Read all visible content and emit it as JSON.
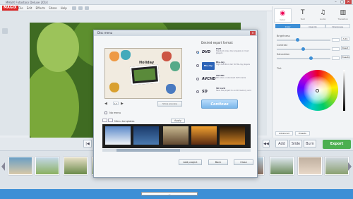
{
  "colors": {
    "accent": "#3d8fd6",
    "export_green": "#4caf50",
    "logo_red": "#dd2222"
  },
  "window": {
    "title": "MAGIX Fotostory Deluxe 2014",
    "icons": [
      "minimize-icon",
      "maximize-icon",
      "close-icon"
    ]
  },
  "menubar": {
    "logo": "MAGIX",
    "items": [
      "File",
      "Edit",
      "Effects",
      "Share",
      "Help"
    ]
  },
  "right_panel": {
    "tabs": [
      {
        "label": "Color",
        "icon": "color-wheel-icon"
      },
      {
        "label": "Text",
        "icon": "text-icon"
      },
      {
        "label": "Audio",
        "icon": "audio-icon"
      },
      {
        "label": "Transition",
        "icon": "transition-icon"
      }
    ],
    "subtabs": [
      "Color",
      "Opacity",
      "Sharpness"
    ],
    "sliders": [
      {
        "label": "Brightness",
        "value": 0.35,
        "button": "Auto"
      },
      {
        "label": "Contrast",
        "value": 0.45,
        "button": "Reset"
      },
      {
        "label": "Saturation",
        "value": 0.6,
        "button": "Presets"
      }
    ],
    "color_label": "Tint",
    "footer": [
      "Advanced",
      "Presets"
    ]
  },
  "dialog": {
    "title": "Disc menu",
    "preview_title": "Holiday",
    "page": "1/1",
    "preview_button": "Show preview",
    "no_menu": "No menu",
    "templates_label": "Menu templates",
    "apply_label": "Apply",
    "format_title": "Desired export format:",
    "formats": [
      {
        "logo": "DVD",
        "name": "DVD",
        "desc": "Standard video disc playable in most players"
      },
      {
        "logo": "Blu-ray",
        "name": "Blu-ray",
        "desc": "High definition disc for Blu-ray players"
      },
      {
        "logo": "AVCHD",
        "name": "AVCHD",
        "desc": "HD video on standard DVD media"
      },
      {
        "logo": "SD",
        "name": "SD card",
        "desc": "Save the project to an SD memory card"
      }
    ],
    "continue_label": "Continue",
    "buttons": [
      "Add project",
      "Back",
      "Close"
    ]
  },
  "transport": {
    "buttons": [
      "|◀",
      "◀◀",
      "▶",
      "▶▶",
      "▶|"
    ],
    "right_buttons": [
      "Add",
      "Slide",
      "Burn"
    ],
    "export_label": "Export"
  },
  "timeline": {
    "clip_label": "..."
  }
}
